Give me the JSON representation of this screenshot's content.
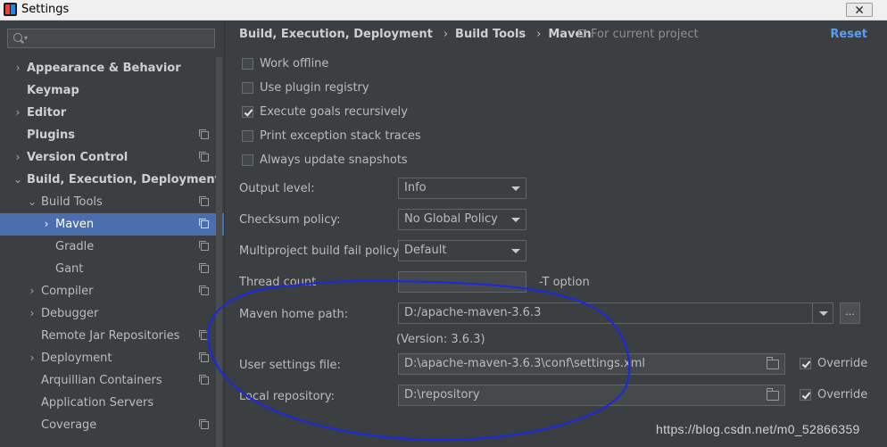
{
  "window": {
    "title": "Settings",
    "close_label": "🗙"
  },
  "sidebar": {
    "items": [
      {
        "label": "Appearance & Behavior",
        "arrow": "›",
        "level": 0,
        "bold": true,
        "icon": false,
        "selected": false
      },
      {
        "label": "Keymap",
        "arrow": "",
        "level": 0,
        "bold": true,
        "icon": false,
        "selected": false
      },
      {
        "label": "Editor",
        "arrow": "›",
        "level": 0,
        "bold": true,
        "icon": false,
        "selected": false
      },
      {
        "label": "Plugins",
        "arrow": "",
        "level": 0,
        "bold": true,
        "icon": true,
        "selected": false
      },
      {
        "label": "Version Control",
        "arrow": "›",
        "level": 0,
        "bold": true,
        "icon": true,
        "selected": false
      },
      {
        "label": "Build, Execution, Deployment",
        "arrow": "⌄",
        "level": 0,
        "bold": true,
        "icon": false,
        "selected": false
      },
      {
        "label": "Build Tools",
        "arrow": "⌄",
        "level": 1,
        "bold": false,
        "icon": true,
        "selected": false
      },
      {
        "label": "Maven",
        "arrow": "›",
        "level": 2,
        "bold": false,
        "icon": true,
        "selected": true
      },
      {
        "label": "Gradle",
        "arrow": "",
        "level": 2,
        "bold": false,
        "icon": true,
        "selected": false
      },
      {
        "label": "Gant",
        "arrow": "",
        "level": 2,
        "bold": false,
        "icon": true,
        "selected": false
      },
      {
        "label": "Compiler",
        "arrow": "›",
        "level": 1,
        "bold": false,
        "icon": true,
        "selected": false
      },
      {
        "label": "Debugger",
        "arrow": "›",
        "level": 1,
        "bold": false,
        "icon": false,
        "selected": false
      },
      {
        "label": "Remote Jar Repositories",
        "arrow": "",
        "level": 1,
        "bold": false,
        "icon": true,
        "selected": false
      },
      {
        "label": "Deployment",
        "arrow": "›",
        "level": 1,
        "bold": false,
        "icon": true,
        "selected": false
      },
      {
        "label": "Arquillian Containers",
        "arrow": "",
        "level": 1,
        "bold": false,
        "icon": true,
        "selected": false
      },
      {
        "label": "Application Servers",
        "arrow": "",
        "level": 1,
        "bold": false,
        "icon": false,
        "selected": false
      },
      {
        "label": "Coverage",
        "arrow": "",
        "level": 1,
        "bold": false,
        "icon": true,
        "selected": false
      }
    ]
  },
  "header": {
    "breadcrumb": [
      "Build, Execution, Deployment",
      "Build Tools",
      "Maven"
    ],
    "separator": "›",
    "scope": "For current project",
    "reset": "Reset"
  },
  "options": [
    {
      "label": "Work offline",
      "checked": false
    },
    {
      "label": "Use plugin registry",
      "checked": false
    },
    {
      "label": "Execute goals recursively",
      "checked": true
    },
    {
      "label": "Print exception stack traces",
      "checked": false
    },
    {
      "label": "Always update snapshots",
      "checked": false
    }
  ],
  "form": {
    "output_level": {
      "label": "Output level:",
      "value": "Info"
    },
    "checksum_policy": {
      "label": "Checksum policy:",
      "value": "No Global Policy"
    },
    "multiproject": {
      "label": "Multiproject build fail policy:",
      "value": "Default"
    },
    "thread_count": {
      "label": "Thread count",
      "value": "",
      "suffix": "-T option"
    },
    "maven_home": {
      "label": "Maven home path:",
      "value": "D:/apache-maven-3.6.3",
      "browse": "...",
      "version": "(Version: 3.6.3)"
    },
    "user_settings": {
      "label": "User settings file:",
      "value": "D:\\apache-maven-3.6.3\\conf\\settings.xml",
      "override_label": "Override",
      "override": true
    },
    "local_repo": {
      "label": "Local repository:",
      "value": "D:\\repository",
      "override_label": "Override",
      "override": true
    }
  },
  "watermark": "https://blog.csdn.net/m0_52866359",
  "colors": {
    "background": "#3c3f41",
    "selection": "#4b6eaf",
    "link": "#589df6",
    "annotation": "#1c2bd9"
  }
}
